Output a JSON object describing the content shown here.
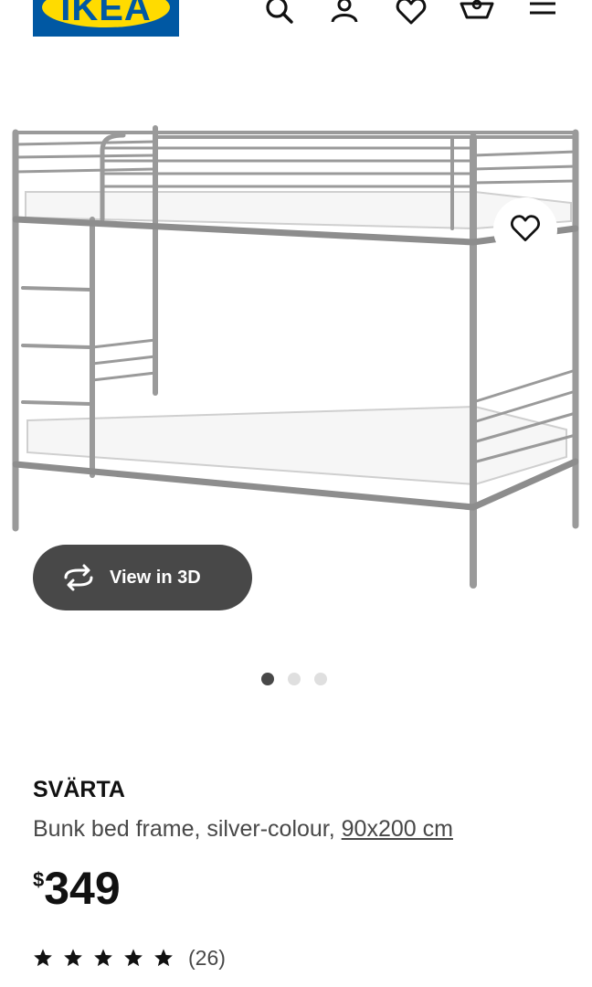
{
  "header": {
    "logo_text": "IKEA",
    "icons": [
      "search-icon",
      "user-icon",
      "heart-icon",
      "cart-icon",
      "menu-icon"
    ]
  },
  "gallery": {
    "view_3d_label": "View in 3D",
    "slide_count": 3,
    "active_slide": 1
  },
  "product": {
    "name": "SVÄRTA",
    "description": "Bunk bed frame, silver-colour, ",
    "size_link": "90x200 cm",
    "currency": "$",
    "price": "349",
    "rating_stars": 5,
    "review_count": "(26)"
  },
  "colors": {
    "ikea_blue": "#0058a3",
    "ikea_yellow": "#ffdb00",
    "dark_pill": "#484848"
  }
}
